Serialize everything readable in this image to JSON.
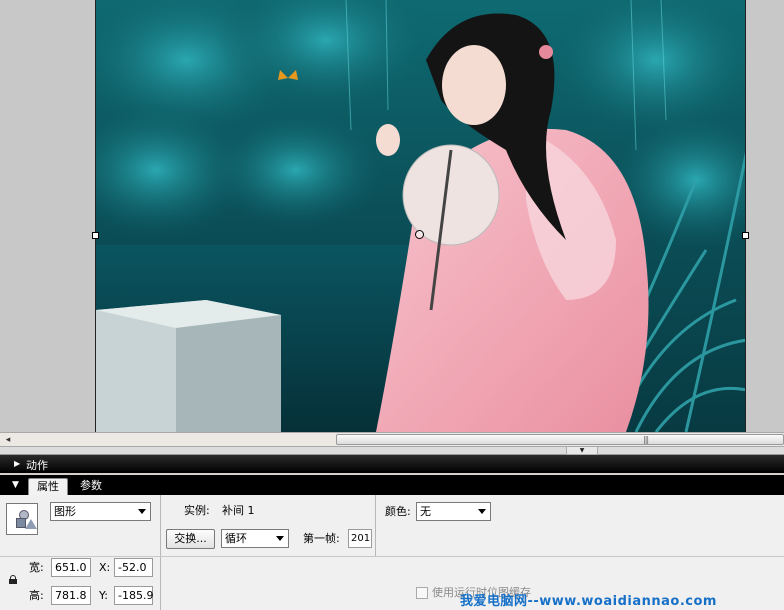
{
  "panels": {
    "actions_title": "动作",
    "tabs": [
      "属性",
      "参数"
    ]
  },
  "properties": {
    "symbol_type": "图形",
    "instance_label": "实例:",
    "instance_name": "补间 1",
    "swap_button": "交换...",
    "loop_option": "循环",
    "first_frame_label": "第一帧:",
    "first_frame_value": "201",
    "color_label": "颜色:",
    "color_value": "无",
    "width_label": "宽:",
    "width_value": "651.0",
    "height_label": "高:",
    "height_value": "781.8",
    "x_label": "X:",
    "x_value": "-52.0",
    "y_label": "Y:",
    "y_value": "-185.9",
    "checkbox_label": "使用运行时位图缓存"
  },
  "watermark": "我爱电脑网--www.woaidiannao.com",
  "icons": {
    "scroll_left": "scroll-left-arrow-icon",
    "collapse": "collapse-down-arrow-icon",
    "panel_toggle": "triangle-expand-icon",
    "symbol": "graphic-symbol-icon",
    "lock": "lock-icon"
  },
  "colors": {
    "panel_header": "#000000",
    "stage_gray": "#c8c8c8",
    "watermark_blue": "#1670c8"
  }
}
